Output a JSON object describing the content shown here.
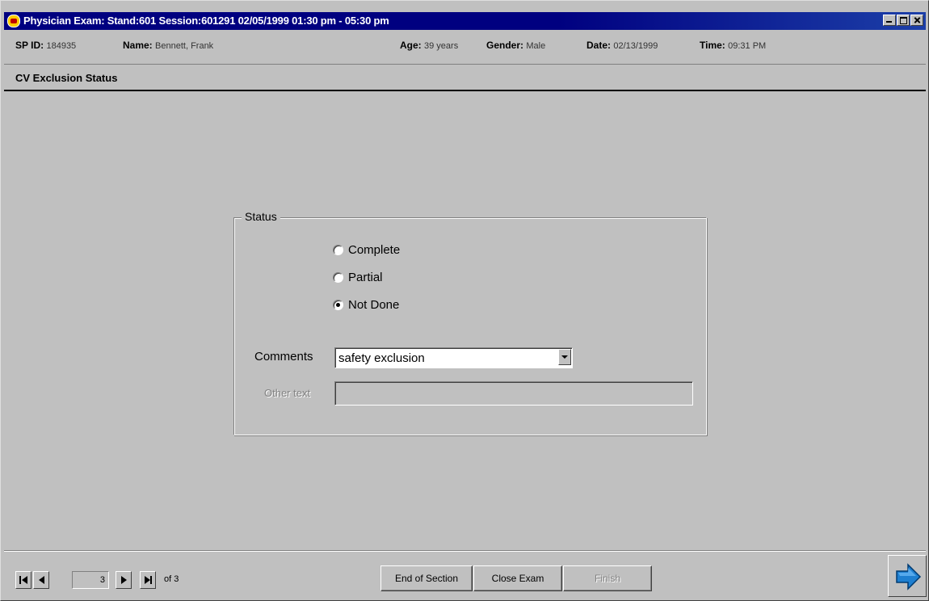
{
  "window": {
    "title": "Physician Exam: Stand:601 Session:601291 02/05/1999 01:30 pm - 05:30 pm",
    "controls": [
      "minimize-icon",
      "maximize-icon",
      "close-icon"
    ]
  },
  "info": {
    "sp_id_label": "SP ID:",
    "sp_id_value": "184935",
    "name_label": "Name:",
    "name_value": "Bennett, Frank",
    "age_label": "Age:",
    "age_value": "39 years",
    "gender_label": "Gender:",
    "gender_value": "Male",
    "date_label": "Date:",
    "date_value": "02/13/1999",
    "time_label": "Time:",
    "time_value": "09:31 PM"
  },
  "section": {
    "title": "CV Exclusion Status"
  },
  "status_group": {
    "legend": "Status",
    "options": [
      {
        "label": "Complete",
        "checked": false
      },
      {
        "label": "Partial",
        "checked": false
      },
      {
        "label": "Not Done",
        "checked": true
      }
    ],
    "comments_label": "Comments",
    "comments_value": "safety exclusion",
    "other_text_label": "Other text",
    "other_text_value": ""
  },
  "navigation": {
    "current_page": "3",
    "of_label": "of 3",
    "icons": [
      "first-page-icon",
      "prev-page-icon",
      "next-page-icon",
      "last-page-icon"
    ]
  },
  "buttons": {
    "end_of_section": "End of Section",
    "close_exam": "Close Exam",
    "finish": "Finish",
    "next_icon": "arrow-right-icon"
  },
  "colors": {
    "titlebar": "#000080",
    "face": "#c0c0c0",
    "next_arrow": "#1e7fd0"
  }
}
